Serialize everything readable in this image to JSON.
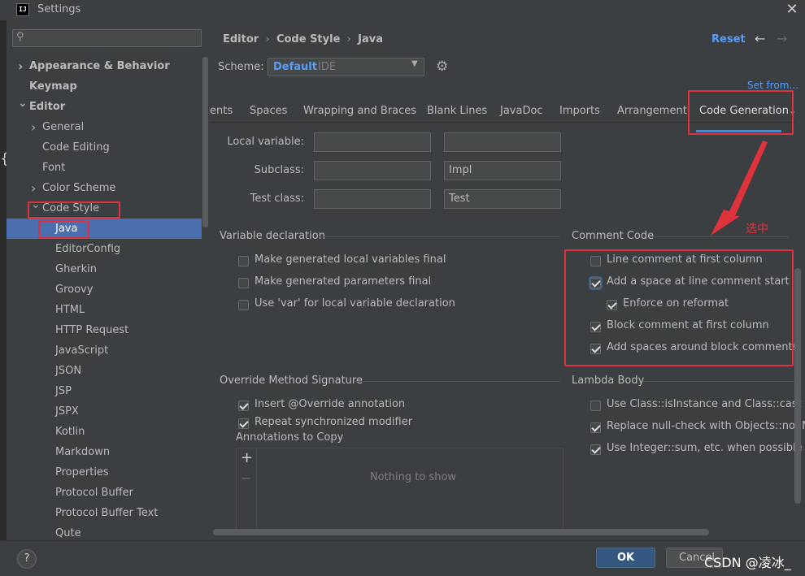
{
  "window": {
    "title": "Settings",
    "app_icon_text": "IJ"
  },
  "sidebar": {
    "search_placeholder": "",
    "items": [
      {
        "label": "Appearance & Behavior",
        "bold": true,
        "arrow": "right"
      },
      {
        "label": "Keymap",
        "bold": true
      },
      {
        "label": "Editor",
        "bold": true,
        "arrow": "down"
      },
      {
        "label": "General",
        "arrow": "right"
      },
      {
        "label": "Code Editing"
      },
      {
        "label": "Font"
      },
      {
        "label": "Color Scheme",
        "arrow": "right"
      },
      {
        "label": "Code Style",
        "arrow": "down"
      },
      {
        "label": "Java",
        "selected": true
      },
      {
        "label": "EditorConfig"
      },
      {
        "label": "Gherkin"
      },
      {
        "label": "Groovy"
      },
      {
        "label": "HTML"
      },
      {
        "label": "HTTP Request"
      },
      {
        "label": "JavaScript"
      },
      {
        "label": "JSON"
      },
      {
        "label": "JSP"
      },
      {
        "label": "JSPX"
      },
      {
        "label": "Kotlin"
      },
      {
        "label": "Markdown"
      },
      {
        "label": "Properties"
      },
      {
        "label": "Protocol Buffer"
      },
      {
        "label": "Protocol Buffer Text"
      },
      {
        "label": "Qute"
      }
    ]
  },
  "header": {
    "breadcrumb": [
      "Editor",
      "Code Style",
      "Java"
    ],
    "reset_label": "Reset",
    "back_icon": "arrow-left-icon",
    "forward_icon": "arrow-right-icon"
  },
  "scheme": {
    "label": "Scheme:",
    "value": "Default",
    "suffix": "IDE",
    "set_from": "Set from..."
  },
  "tabs": [
    "ents",
    "Spaces",
    "Wrapping and Braces",
    "Blank Lines",
    "JavaDoc",
    "Imports",
    "Arrangement",
    "Code Generation"
  ],
  "active_tab": "Code Generation",
  "naming": {
    "rows": [
      {
        "label": "Local variable:",
        "prefix": "",
        "suffix": ""
      },
      {
        "label": "Subclass:",
        "prefix": "",
        "suffix": "Impl"
      },
      {
        "label": "Test class:",
        "prefix": "",
        "suffix": "Test"
      }
    ]
  },
  "variable_declaration": {
    "title": "Variable declaration",
    "options": [
      {
        "label": "Make generated local variables final",
        "checked": false
      },
      {
        "label": "Make generated parameters final",
        "checked": false
      },
      {
        "label": "Use 'var' for local variable declaration",
        "checked": false
      }
    ]
  },
  "comment_code": {
    "title": "Comment Code",
    "options": [
      {
        "label": "Line comment at first column",
        "checked": false
      },
      {
        "label": "Add a space at line comment start",
        "checked": true
      },
      {
        "label": "Enforce on reformat",
        "checked": true
      },
      {
        "label": "Block comment at first column",
        "checked": true
      },
      {
        "label": "Add spaces around block comments",
        "checked": true
      }
    ]
  },
  "override": {
    "title": "Override Method Signature",
    "options": [
      {
        "label": "Insert @Override annotation",
        "checked": true
      },
      {
        "label": "Repeat synchronized modifier",
        "checked": true
      }
    ],
    "annotations_label": "Annotations to Copy",
    "empty_text": "Nothing to show"
  },
  "lambda": {
    "title": "Lambda Body",
    "options": [
      {
        "label": "Use Class::isInstance and Class::cast when",
        "checked": false
      },
      {
        "label": "Replace null-check with Objects::nonNull o",
        "checked": true
      },
      {
        "label": "Use Integer::sum, etc. when possible",
        "checked": true
      }
    ]
  },
  "annotation_text": "选中",
  "footer": {
    "help": "?",
    "ok": "OK",
    "cancel": "Cancel",
    "watermark": "CSDN @凌冰_"
  },
  "colors": {
    "accent": "#589df6",
    "selection": "#4b6eaf",
    "highlight_red": "#e0323c",
    "ok_button": "#365880"
  }
}
